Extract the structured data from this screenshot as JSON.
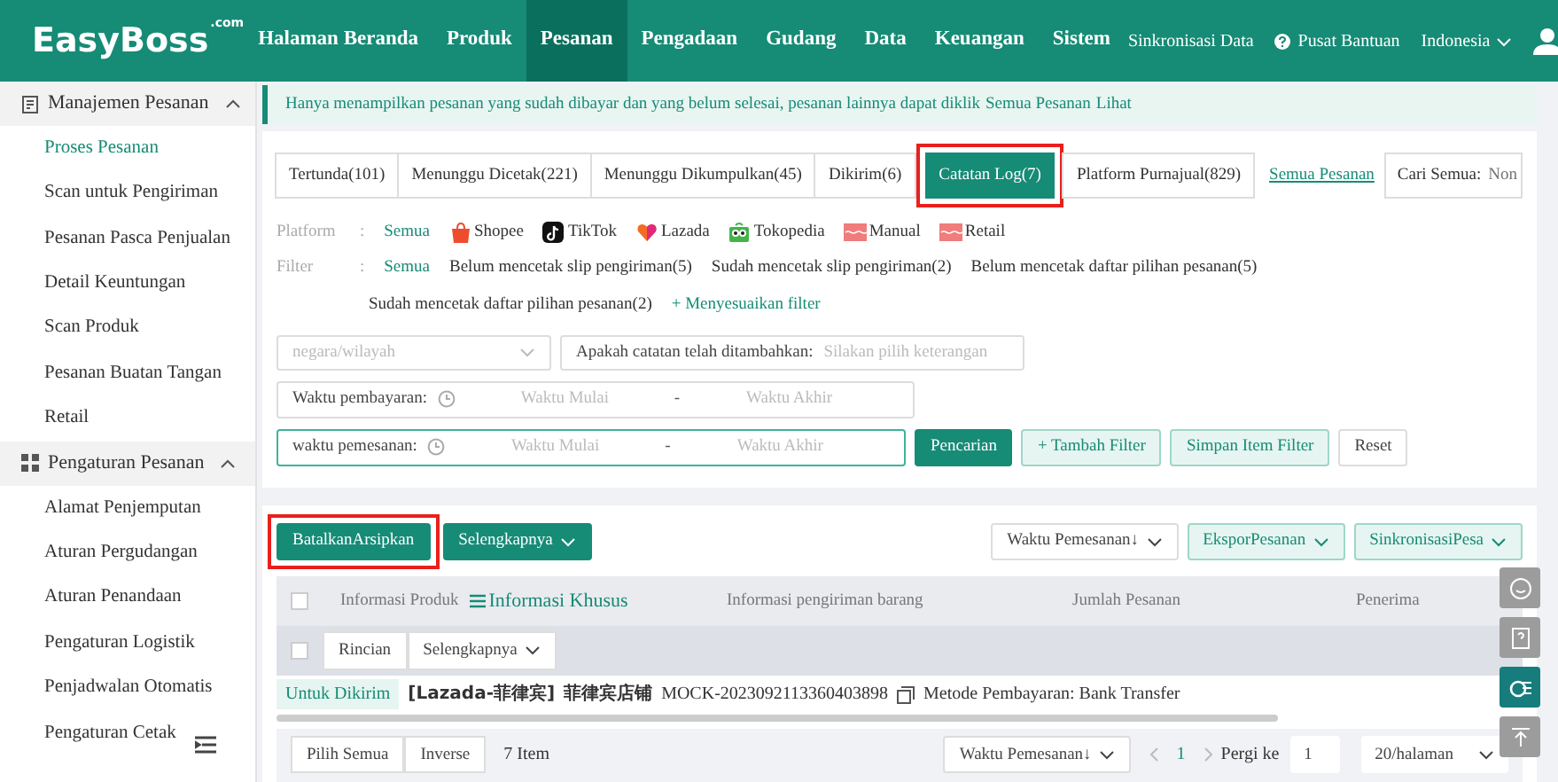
{
  "header": {
    "logo": "EasyBoss",
    "logo_suffix": ".com",
    "nav": [
      {
        "label": "Halaman Beranda",
        "selected": false
      },
      {
        "label": "Produk",
        "selected": false
      },
      {
        "label": "Pesanan",
        "selected": true
      },
      {
        "label": "Pengadaan",
        "selected": false
      },
      {
        "label": "Gudang",
        "selected": false
      },
      {
        "label": "Data",
        "selected": false
      },
      {
        "label": "Keuangan",
        "selected": false
      },
      {
        "label": "Sistem",
        "selected": false
      }
    ],
    "sync_link": "Sinkronisasi Data",
    "help_link": "Pusat Bantuan",
    "language": "Indonesia"
  },
  "sidebar": {
    "groups": [
      {
        "label": "Manajemen Pesanan",
        "kind": "orders",
        "expanded": true,
        "items": [
          {
            "label": "Proses Pesanan",
            "selected": true
          },
          {
            "label": "Scan untuk Pengiriman",
            "selected": false
          },
          {
            "label": "Pesanan Pasca Penjualan",
            "selected": false
          },
          {
            "label": "Detail Keuntungan",
            "selected": false
          },
          {
            "label": "Scan Produk",
            "selected": false
          },
          {
            "label": "Pesanan Buatan Tangan",
            "selected": false
          },
          {
            "label": "Retail",
            "selected": false
          }
        ]
      },
      {
        "label": "Pengaturan Pesanan",
        "kind": "settings",
        "expanded": true,
        "items": [
          {
            "label": "Alamat Penjemputan",
            "selected": false
          },
          {
            "label": "Aturan Pergudangan",
            "selected": false
          },
          {
            "label": "Aturan Penandaan",
            "selected": false
          },
          {
            "label": "Pengaturan Logistik",
            "selected": false
          },
          {
            "label": "Penjadwalan Otomatis",
            "selected": false
          },
          {
            "label": "Pengaturan Cetak",
            "selected": false
          }
        ]
      }
    ]
  },
  "notice": {
    "text": "Hanya menampilkan pesanan yang sudah dibayar dan yang belum selesai, pesanan lainnya dapat diklik",
    "link": "Semua Pesanan",
    "suffix": "Lihat"
  },
  "tabs": [
    {
      "label": "Tertunda(101)",
      "selected": false,
      "highlighted": false
    },
    {
      "label": "Menunggu Dicetak(221)",
      "selected": false,
      "highlighted": false
    },
    {
      "label": "Menunggu Dikumpulkan(45)",
      "selected": false,
      "highlighted": false
    },
    {
      "label": "Dikirim(6)",
      "selected": false,
      "highlighted": false
    },
    {
      "label": "Catatan Log(7)",
      "selected": true,
      "highlighted": true
    },
    {
      "label": "Platform Purnajual(829)",
      "selected": false,
      "highlighted": false
    }
  ],
  "all_orders_link": "Semua Pesanan",
  "search": {
    "label": "Cari Semua:",
    "placeholder": "Non"
  },
  "platform_filter": {
    "label": "Platform",
    "separator": ":",
    "options": [
      {
        "label": "Semua",
        "kind": "all",
        "selected": true
      },
      {
        "label": "Shopee",
        "kind": "shopee",
        "selected": false
      },
      {
        "label": "TikTok",
        "kind": "tiktok",
        "selected": false
      },
      {
        "label": "Lazada",
        "kind": "lazada",
        "selected": false
      },
      {
        "label": "Tokopedia",
        "kind": "tokopedia",
        "selected": false
      },
      {
        "label": "Manual",
        "kind": "manual",
        "selected": false
      },
      {
        "label": "Retail",
        "kind": "retail",
        "selected": false
      }
    ]
  },
  "status_filter": {
    "label": "Filter",
    "separator": ":",
    "options": [
      {
        "label": "Semua",
        "selected": true
      },
      {
        "label": "Belum mencetak slip pengiriman(5)",
        "selected": false
      },
      {
        "label": "Sudah mencetak slip pengiriman(2)",
        "selected": false
      },
      {
        "label": "Belum mencetak daftar pilihan pesanan(5)",
        "selected": false
      },
      {
        "label": "Sudah mencetak daftar pilihan pesanan(2)",
        "selected": false
      }
    ],
    "customize": "+ Menyesuaikan filter"
  },
  "region_select": {
    "placeholder": "negara/wilayah"
  },
  "note_select": {
    "label": "Apakah catatan telah ditambahkan:",
    "placeholder": "Silakan pilih keterangan"
  },
  "date_ranges": [
    {
      "label": "Waktu pembayaran:",
      "start_placeholder": "Waktu Mulai",
      "separator": "-",
      "end_placeholder": "Waktu Akhir",
      "focused": false
    },
    {
      "label": "waktu pemesanan:",
      "start_placeholder": "Waktu Mulai",
      "separator": "-",
      "end_placeholder": "Waktu Akhir",
      "focused": true
    }
  ],
  "filter_buttons": [
    {
      "label": "Pencarian",
      "kind": "primary"
    },
    {
      "label": "+ Tambah Filter",
      "kind": "light"
    },
    {
      "label": "Simpan Item Filter",
      "kind": "light"
    },
    {
      "label": "Reset",
      "kind": "plain"
    }
  ],
  "actions": [
    {
      "label": "BatalkanArsipkan",
      "kind": "primary",
      "highlighted": true
    },
    {
      "label": "Selengkapnya",
      "kind": "dropdown",
      "highlighted": false
    }
  ],
  "right_actions": [
    {
      "label": "Waktu Pemesanan↓",
      "kind": "select"
    },
    {
      "label": "EksporPesanan",
      "kind": "light"
    },
    {
      "label": "SinkronisasiPesa",
      "kind": "light"
    }
  ],
  "table": {
    "header_checked": false,
    "sub_checked": false,
    "columns": [
      "Informasi Produk",
      "Informasi Khusus",
      "Informasi pengiriman barang",
      "Jumlah Pesanan",
      "Penerima"
    ],
    "sub_actions": [
      "Rincian",
      "Selengkapnya"
    ],
    "rows": [
      {
        "status": "Untuk Dikirim",
        "store": "[Lazada-菲律宾]",
        "shop": "菲律宾店铺",
        "order_id": "MOCK-2023092113360403898",
        "payment": "Metode Pembayaran: Bank Transfer"
      }
    ]
  },
  "footer": {
    "select_all": "Pilih Semua",
    "inverse": "Inverse",
    "count": "7 Item",
    "sort": "Waktu Pemesanan↓",
    "pages": [
      {
        "label": "1",
        "selected": true
      }
    ],
    "goto_label": "Pergi ke",
    "goto_value": "1",
    "page_size": "20/halaman"
  }
}
